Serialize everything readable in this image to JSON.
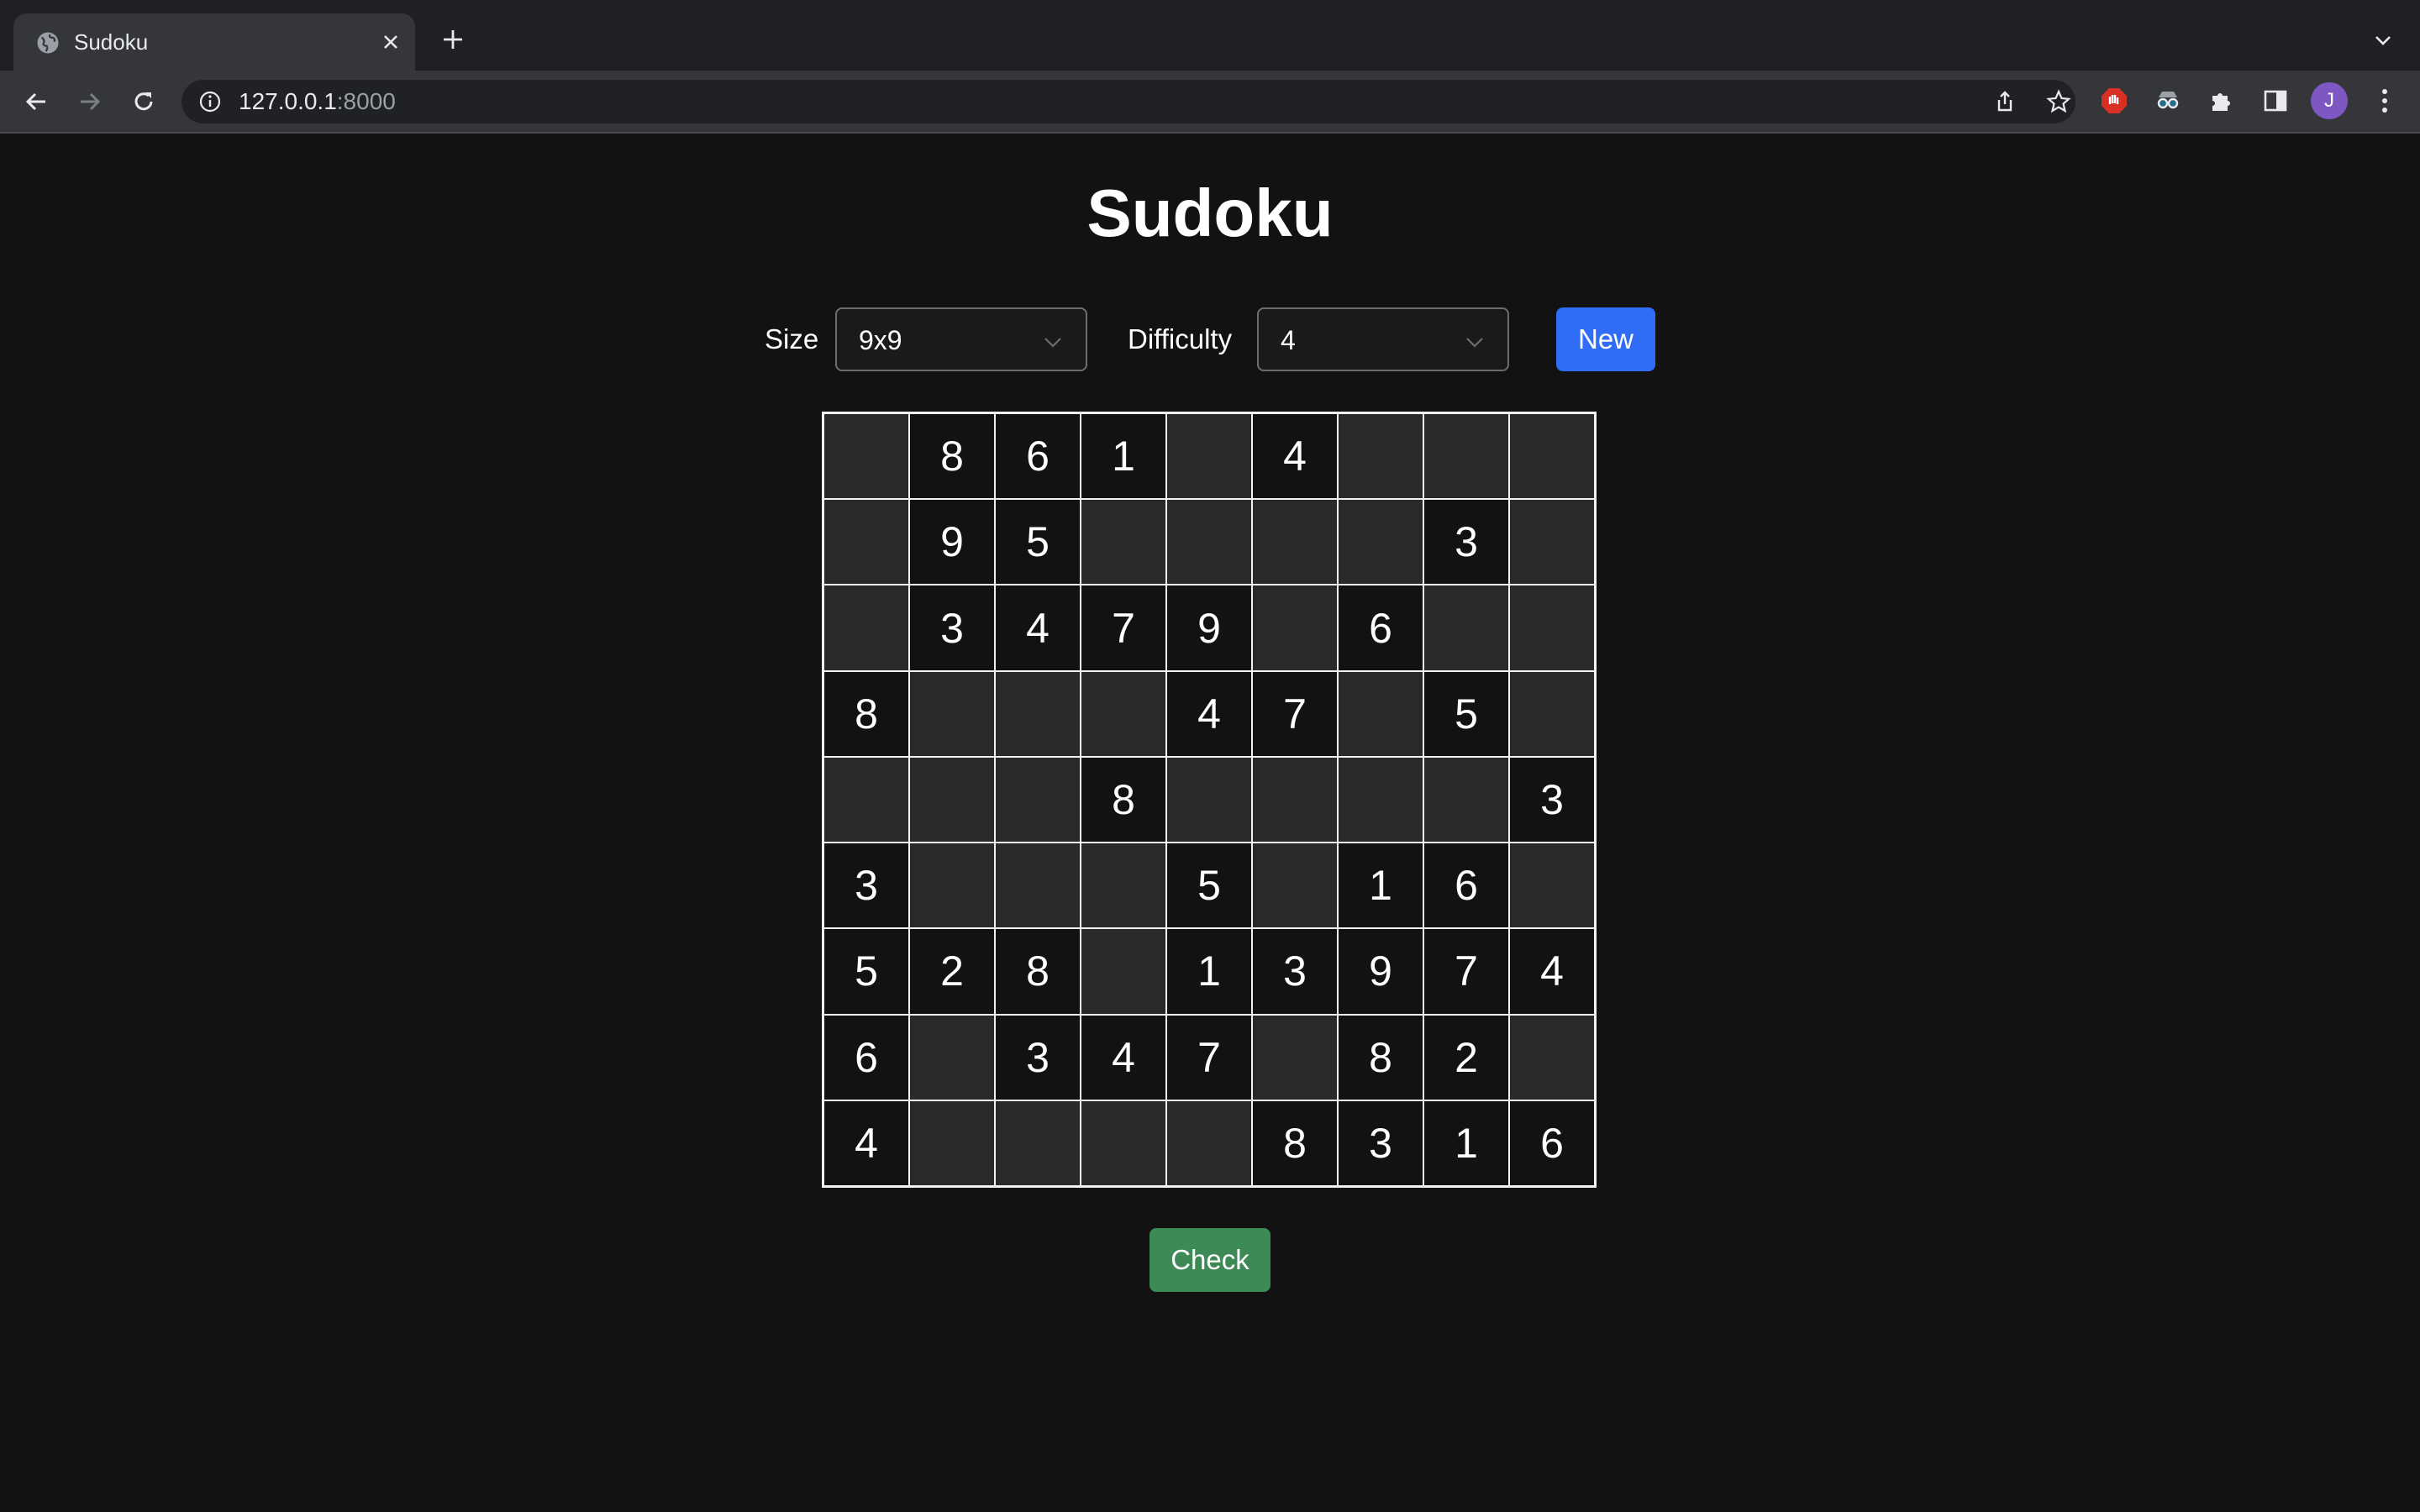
{
  "browser": {
    "tab_title": "Sudoku",
    "url_host": "127.0.0.1",
    "url_port": ":8000",
    "avatar_initial": "J"
  },
  "page": {
    "title": "Sudoku",
    "size_label": "Size",
    "size_value": "9x9",
    "difficulty_label": "Difficulty",
    "difficulty_value": "4",
    "new_button": "New",
    "check_button": "Check"
  },
  "colors": {
    "background": "#121212",
    "new_button": "#2f6df6",
    "check_button": "#3e8a56",
    "empty_cell": "#2a2a2a"
  },
  "board": [
    [
      "",
      "8",
      "6",
      "1",
      "",
      "4",
      "",
      "",
      ""
    ],
    [
      "",
      "9",
      "5",
      "",
      "",
      "",
      "",
      "3",
      ""
    ],
    [
      "",
      "3",
      "4",
      "7",
      "9",
      "",
      "6",
      "",
      ""
    ],
    [
      "8",
      "",
      "",
      "",
      "4",
      "7",
      "",
      "5",
      ""
    ],
    [
      "",
      "",
      "",
      "8",
      "",
      "",
      "",
      "",
      "3"
    ],
    [
      "3",
      "",
      "",
      "",
      "5",
      "",
      "1",
      "6",
      ""
    ],
    [
      "5",
      "2",
      "8",
      "",
      "1",
      "3",
      "9",
      "7",
      "4"
    ],
    [
      "6",
      "",
      "3",
      "4",
      "7",
      "",
      "8",
      "2",
      ""
    ],
    [
      "4",
      "",
      "",
      "",
      "",
      "8",
      "3",
      "1",
      "6"
    ]
  ]
}
